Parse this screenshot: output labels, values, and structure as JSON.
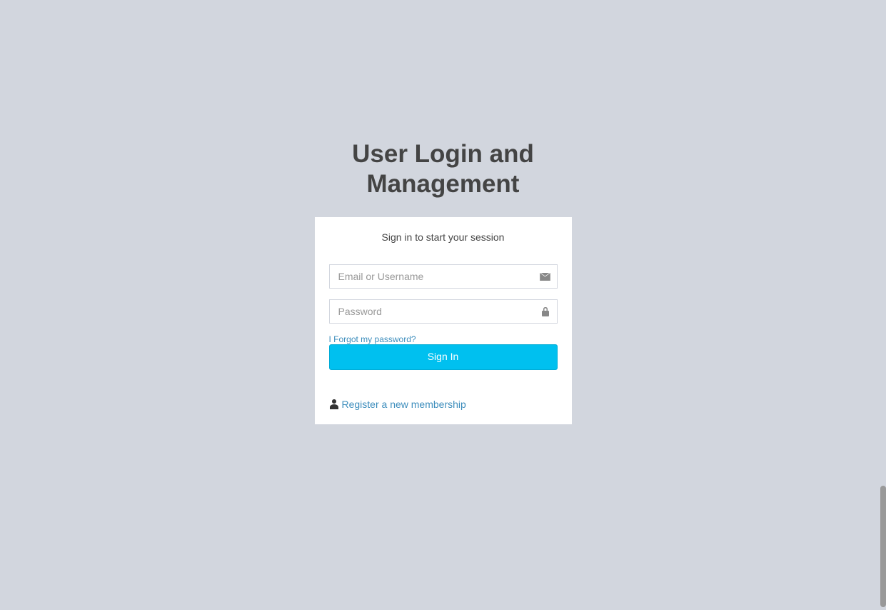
{
  "page": {
    "title": "User Login and Management",
    "subtitle": "Sign in to start your session"
  },
  "form": {
    "email": {
      "placeholder": "Email or Username",
      "value": ""
    },
    "password": {
      "placeholder": "Password",
      "value": ""
    },
    "forgot_password_label": "I Forgot my password?",
    "submit_label": "Sign In",
    "register_label": "Register a new membership"
  }
}
